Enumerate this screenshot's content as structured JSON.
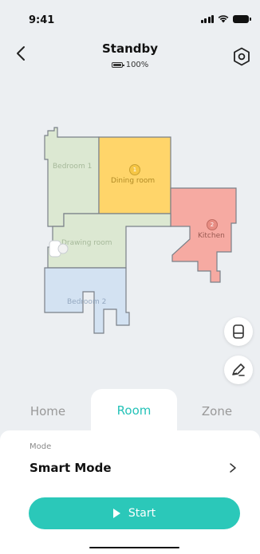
{
  "status_bar": {
    "time": "9:41"
  },
  "header": {
    "title": "Standby",
    "battery": "100%"
  },
  "map": {
    "rooms": [
      {
        "name": "Bedroom 1",
        "color": "#dce8d2",
        "text_color": "#a6b99a"
      },
      {
        "name": "Dining room",
        "badge": "1",
        "color": "#ffd56a",
        "text_color": "#b08a25"
      },
      {
        "name": "Kitchen",
        "badge": "2",
        "color": "#f6aaa2",
        "text_color": "#9a5a52"
      },
      {
        "name": "Drawing room",
        "color": "#dce8d2",
        "text_color": "#a6b99a"
      },
      {
        "name": "Bedroom 2",
        "color": "#d3e2f2",
        "text_color": "#94a8c0"
      }
    ],
    "outline_color": "#7a8088"
  },
  "tabs": [
    {
      "label": "Home",
      "active": false
    },
    {
      "label": "Room",
      "active": true
    },
    {
      "label": "Zone",
      "active": false
    }
  ],
  "mode": {
    "label": "Mode",
    "value": "Smart Mode"
  },
  "start_button": {
    "label": "Start",
    "color": "#2bc8b9"
  },
  "accent_color": "#25c2b8",
  "icons": {
    "back": "chevron-left-icon",
    "settings": "hexagon-gear-icon",
    "dock": "dock-station-icon",
    "edit": "edit-pencil-icon",
    "chevron": "chevron-right-icon"
  }
}
